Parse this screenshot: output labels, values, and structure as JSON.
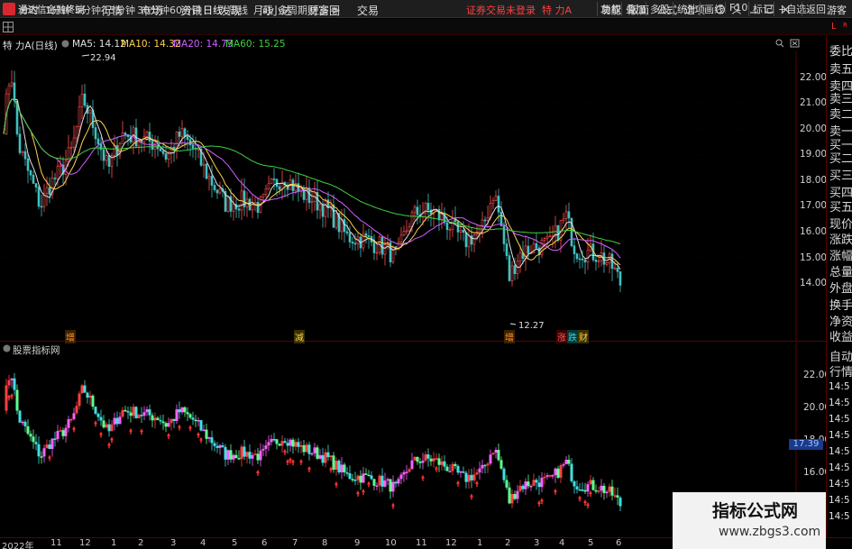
{
  "app": {
    "name": "通达信金融终端",
    "notice": "证券交易未登录",
    "symbol_title": "特 力A",
    "guest": "游客"
  },
  "menu": [
    "行情",
    "市场",
    "资讯",
    "发现",
    "问小达",
    "财富圈",
    "交易"
  ],
  "right_menu": [
    "功能",
    "版面",
    "公式",
    "选项"
  ],
  "toolbar": {
    "periods": [
      "分时",
      "1分钟",
      "5分钟",
      "15分钟",
      "30分钟",
      "60分钟",
      "日线",
      "周线",
      "月线",
      "多周期",
      "更多 >"
    ],
    "selected_period": "日线",
    "right_buttons": [
      "复权",
      "叠加",
      "多股",
      "统计",
      "画线",
      "F10",
      "标记",
      "+自选",
      "返回"
    ]
  },
  "info": {
    "name": "特 力A",
    "period": "(日线)",
    "ma": [
      {
        "label": "MA5: 14.12",
        "color": "#e0e0e0"
      },
      {
        "label": "MA10: 14.32",
        "color": "#ffd24a"
      },
      {
        "label": "MA20: 14.73",
        "color": "#d060ff"
      },
      {
        "label": "MA60: 15.25",
        "color": "#40d040"
      }
    ]
  },
  "main_axis": {
    "labels": [
      "22.00",
      "21.00",
      "20.00",
      "19.00",
      "18.00",
      "17.00",
      "16.00",
      "15.00",
      "14.00"
    ]
  },
  "annotations": {
    "high": "22.94",
    "low": "12.27"
  },
  "events": [
    {
      "text": "增",
      "color": "#ff9030"
    },
    {
      "text": "减",
      "color": "#ffd24a"
    },
    {
      "text": "增",
      "color": "#ff9030"
    },
    {
      "text": "涨",
      "color": "#ff6060"
    },
    {
      "text": "跌",
      "color": "#40d0d0"
    },
    {
      "text": "财",
      "color": "#ffd24a"
    }
  ],
  "indicator": {
    "header": "股票指标网",
    "axis_labels": [
      "22.00",
      "20.00",
      "18.00",
      "16.00"
    ],
    "current": "17.39"
  },
  "right_panel": {
    "labels": [
      "委比",
      "卖五",
      "卖四",
      "卖三",
      "卖二",
      "卖一",
      "买一",
      "买二",
      "买三",
      "买四",
      "买五",
      "现价",
      "涨跌",
      "涨幅",
      "总量",
      "外盘",
      "换手",
      "净资",
      "收益",
      "自动",
      "行情"
    ],
    "times": [
      "14:5",
      "14:5",
      "14:5",
      "14:5",
      "14:5",
      "14:5",
      "14:5",
      "14:5",
      "14:5"
    ]
  },
  "date_axis": [
    "2022年",
    "11",
    "12",
    "1",
    "2",
    "3",
    "4",
    "5",
    "6",
    "7",
    "8",
    "9",
    "10",
    "11",
    "12",
    "1",
    "2",
    "3",
    "4",
    "5",
    "6"
  ],
  "watermark": {
    "title": "指标公式网",
    "url": "www.zbgs3.com"
  }
}
